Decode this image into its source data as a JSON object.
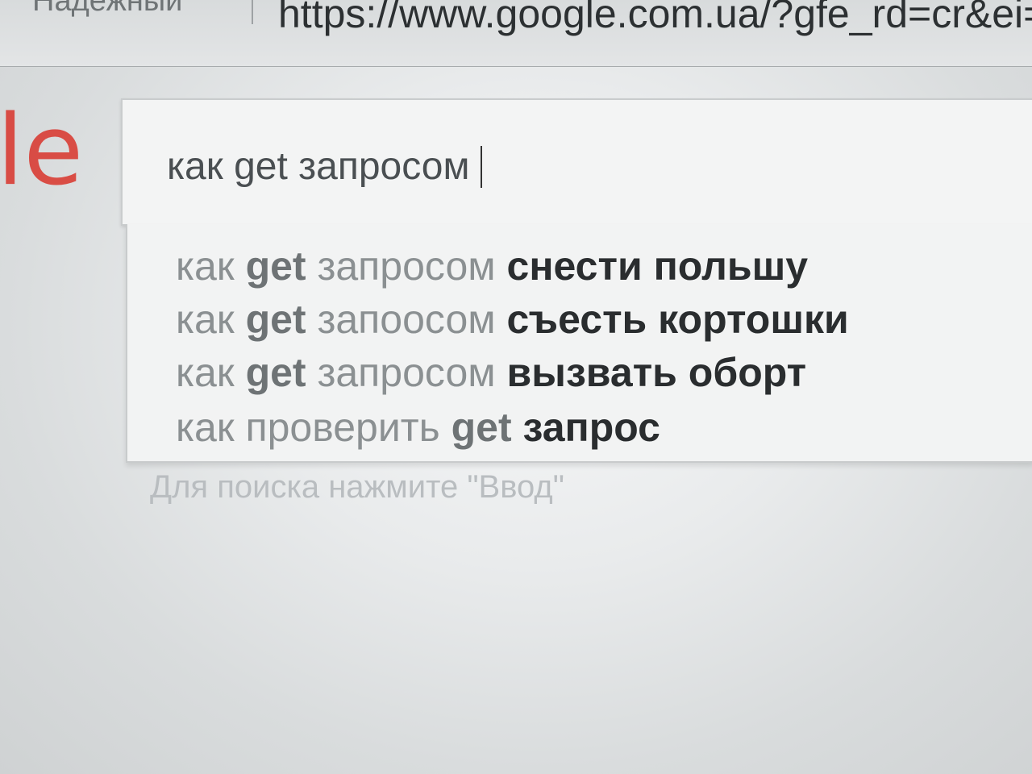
{
  "browser": {
    "security_label": "Надежный",
    "url": "https://www.google.com.ua/?gfe_rd=cr&ei=lBXdV"
  },
  "logo": {
    "visible_letter": "le"
  },
  "search": {
    "query": "как get запросом"
  },
  "suggestions": [
    {
      "prefix": "как ",
      "keyword": "get",
      "middle": " запросом ",
      "completion": "снести польшу"
    },
    {
      "prefix": "как ",
      "keyword": "get",
      "middle": " запоосом ",
      "completion": "съесть кортошки"
    },
    {
      "prefix": "как ",
      "keyword": "get",
      "middle": " запросом ",
      "completion": "вызвать оборт"
    },
    {
      "prefix": "как проверить ",
      "keyword": "get",
      "middle": " ",
      "completion": "запрос"
    }
  ],
  "hint": "Для поиска нажмите \"Ввод\"",
  "colors": {
    "logo_red": "#d9342b",
    "bold_text": "#2a2d2f",
    "light_text": "#8b9092"
  }
}
